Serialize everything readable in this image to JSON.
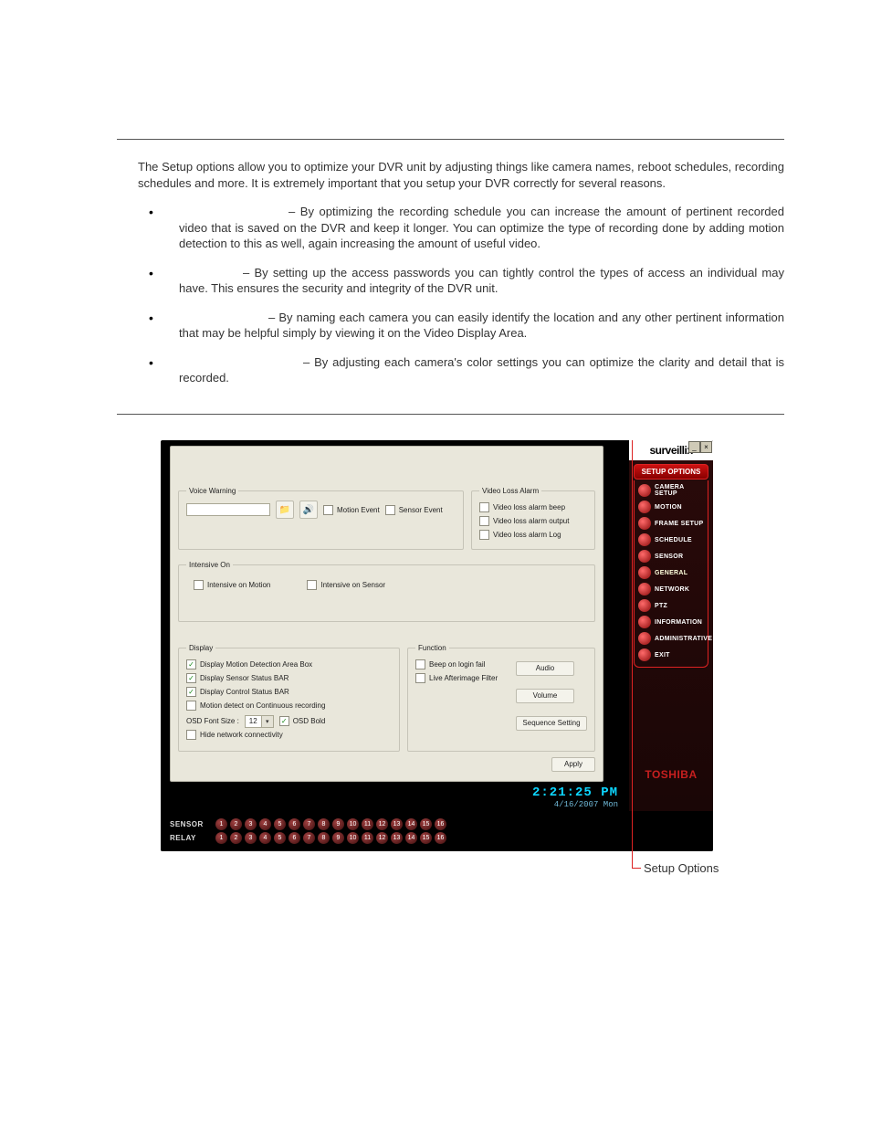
{
  "intro": "The Setup options allow you to optimize your DVR unit by adjusting things like camera names, reboot schedules, recording schedules and more. It is extremely important that you setup your DVR correctly for several reasons.",
  "bullets": [
    "– By optimizing the recording schedule you can increase the amount of pertinent recorded video that is saved on the DVR and keep it longer. You can optimize the type of recording done by adding motion detection to this as well, again increasing the amount of useful video.",
    "– By setting up the access passwords you can tightly control the types of access an individual may have. This ensures the security and integrity of the DVR unit.",
    "– By naming each camera you can easily identify the location and any other pertinent information that may be helpful simply by viewing it on the Video Display Area.",
    "– By adjusting each camera's color settings you can optimize the clarity and detail that is recorded."
  ],
  "dialog": {
    "group_voice": "Voice Warning",
    "chk_motion_event": "Motion Event",
    "chk_sensor_event": "Sensor Event",
    "group_video_loss": "Video Loss Alarm",
    "chk_vloss_beep": "Video loss alarm beep",
    "chk_vloss_output": "Video loss alarm output",
    "chk_vloss_log": "Video loss alarm Log",
    "group_intensive": "Intensive On",
    "chk_int_motion": "Intensive on Motion",
    "chk_int_sensor": "Intensive on Sensor",
    "group_display": "Display",
    "chk_disp_mdab": "Display Motion Detection Area Box",
    "chk_disp_ssbar": "Display Sensor Status BAR",
    "chk_disp_csbar": "Display Control Status BAR",
    "chk_md_contrec": "Motion detect on Continuous recording",
    "osd_fontsize_label": "OSD Font Size :",
    "osd_fontsize_value": "12",
    "chk_osd_bold": "OSD Bold",
    "chk_hide_netconn": "Hide network connectivity",
    "group_function": "Function",
    "chk_beep_loginfail": "Beep on login fail",
    "chk_live_afterimage": "Live Afterimage Filter",
    "btn_audio": "Audio",
    "btn_volume": "Volume",
    "btn_seqset": "Sequence Setting",
    "btn_apply": "Apply"
  },
  "clock": {
    "time": "2:21:25 PM",
    "date": "4/16/2007 Mon"
  },
  "brand": "surveillix",
  "toshiba": "TOSHIBA",
  "setup_options_header": "SETUP OPTIONS",
  "menu": [
    "CAMERA SETUP",
    "MOTION",
    "FRAME SETUP",
    "SCHEDULE",
    "SENSOR",
    "GENERAL",
    "NETWORK",
    "PTZ",
    "INFORMATION",
    "ADMINISTRATIVE",
    "EXIT"
  ],
  "sensor_label": "SENSOR",
  "relay_label": "RELAY",
  "indicators": [
    "1",
    "2",
    "3",
    "4",
    "5",
    "6",
    "7",
    "8",
    "9",
    "10",
    "11",
    "12",
    "13",
    "14",
    "15",
    "16"
  ],
  "callout": "Setup Options"
}
